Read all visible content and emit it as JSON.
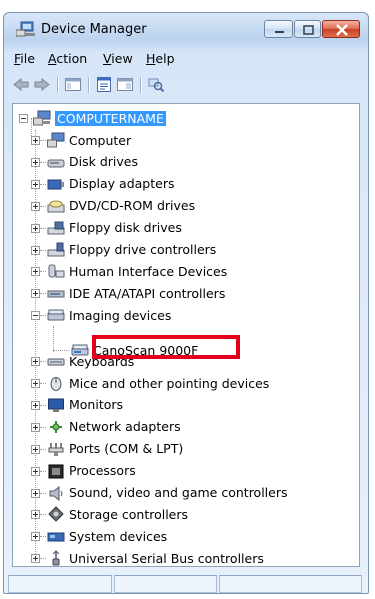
{
  "window": {
    "title": "Device Manager"
  },
  "menu": [
    {
      "underline": "F",
      "rest": "ile"
    },
    {
      "underline": "A",
      "rest": "ction"
    },
    {
      "underline": "V",
      "rest": "iew"
    },
    {
      "underline": "H",
      "rest": "elp"
    }
  ],
  "toolbar": {
    "icons": [
      "back-arrow-icon",
      "forward-arrow-icon",
      "show-hide-console-tree-icon",
      "properties-icon",
      "help-icon",
      "scan-hardware-icon"
    ]
  },
  "tree": {
    "root": "COMPUTERNAME",
    "categories": [
      {
        "label": "Computer",
        "icon": "computer-icon"
      },
      {
        "label": "Disk drives",
        "icon": "disk-drive-icon"
      },
      {
        "label": "Display adapters",
        "icon": "display-adapter-icon"
      },
      {
        "label": "DVD/CD-ROM drives",
        "icon": "dvd-drive-icon"
      },
      {
        "label": "Floppy disk drives",
        "icon": "floppy-disk-icon"
      },
      {
        "label": "Floppy drive controllers",
        "icon": "floppy-controller-icon"
      },
      {
        "label": "Human Interface Devices",
        "icon": "hid-icon"
      },
      {
        "label": "IDE ATA/ATAPI controllers",
        "icon": "ide-controller-icon"
      },
      {
        "label": "Imaging devices",
        "icon": "imaging-device-icon",
        "expanded": true
      },
      {
        "label": "Keyboards",
        "icon": "keyboard-icon"
      },
      {
        "label": "Mice and other pointing devices",
        "icon": "mouse-icon"
      },
      {
        "label": "Monitors",
        "icon": "monitor-icon"
      },
      {
        "label": "Network adapters",
        "icon": "network-adapter-icon"
      },
      {
        "label": "Ports (COM & LPT)",
        "icon": "port-icon"
      },
      {
        "label": "Processors",
        "icon": "processor-icon"
      },
      {
        "label": "Sound, video and game controllers",
        "icon": "sound-icon"
      },
      {
        "label": "Storage controllers",
        "icon": "storage-controller-icon"
      },
      {
        "label": "System devices",
        "icon": "system-device-icon"
      },
      {
        "label": "Universal Serial Bus controllers",
        "icon": "usb-icon"
      }
    ],
    "imaging_child": "CanoScan 9000F",
    "highlight_color": "#e2001a",
    "selection_color": "#3399ff"
  }
}
